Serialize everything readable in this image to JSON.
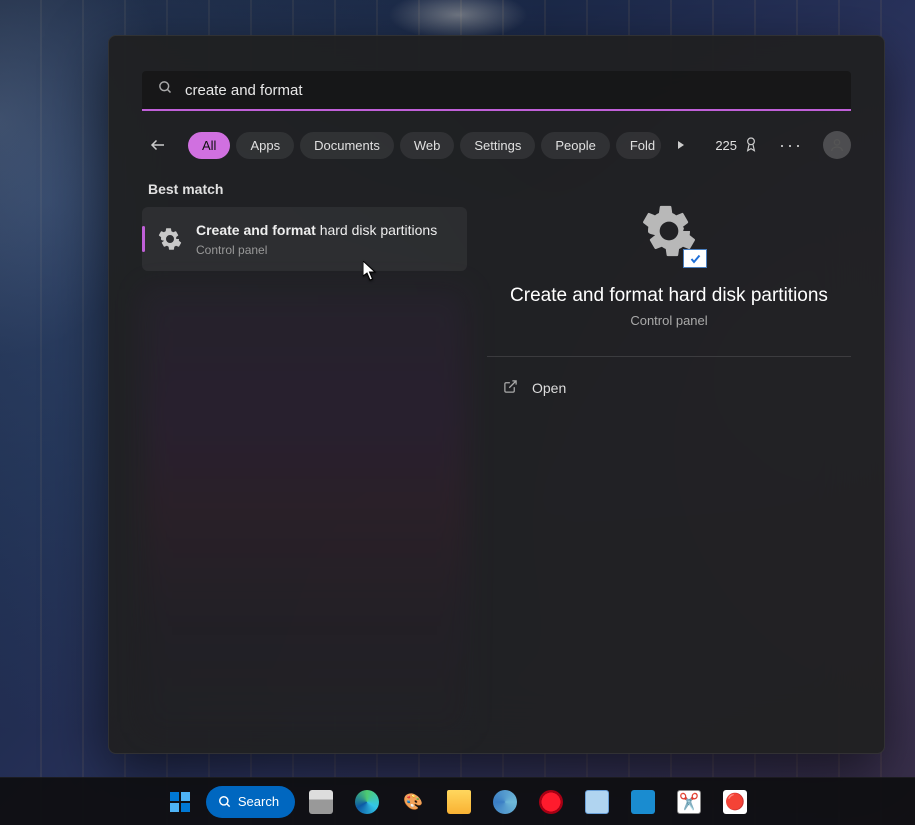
{
  "search": {
    "value": "create and format"
  },
  "filters": {
    "items": [
      "All",
      "Apps",
      "Documents",
      "Web",
      "Settings",
      "People",
      "Folders"
    ],
    "active": 0
  },
  "rewards": {
    "points": "225"
  },
  "results": {
    "section_label": "Best match",
    "best": {
      "title_bold": "Create and format",
      "title_rest": " hard disk partitions",
      "sub": "Control panel"
    }
  },
  "detail": {
    "title": "Create and format hard disk partitions",
    "sub": "Control panel",
    "actions": {
      "open": "Open"
    }
  },
  "taskbar": {
    "search_label": "Search"
  },
  "colors": {
    "accent": "#c060d8",
    "pill_active": "#d070e0",
    "taskbar_search": "#0067c0"
  }
}
